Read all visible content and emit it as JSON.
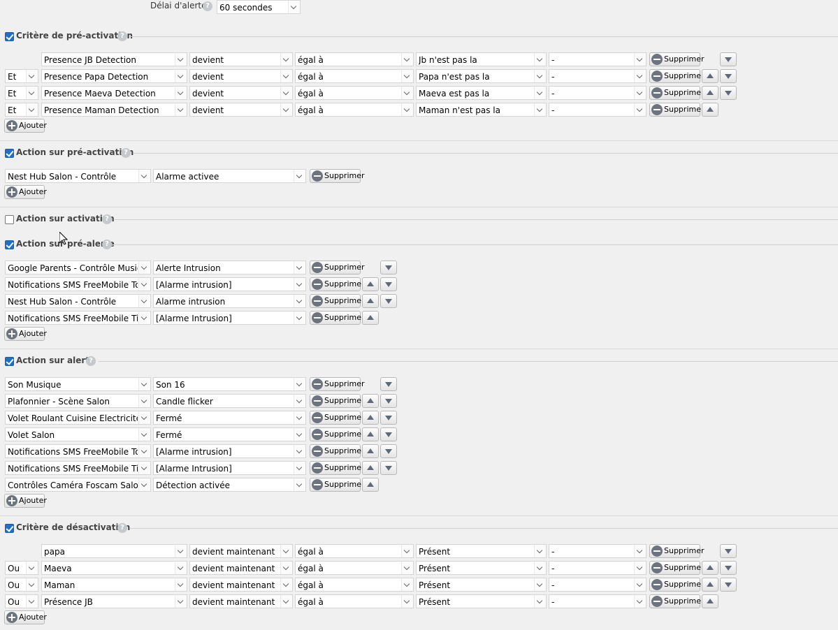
{
  "alert_delay": {
    "label": "Délai d'alerte",
    "value": "60 secondes"
  },
  "labels": {
    "delete": "Supprimer",
    "add": "Ajouter"
  },
  "sections": {
    "pre_activation_criteria": {
      "title": "Critère de pré-activation",
      "checked": true,
      "rows": [
        {
          "op": "",
          "cmd": "Presence JB Detection",
          "trigger": "devient",
          "cmp": "égal à",
          "val": "Jb n'est pas la",
          "extra": "-"
        },
        {
          "op": "Et",
          "cmd": "Presence Papa Detection",
          "trigger": "devient",
          "cmp": "égal à",
          "val": "Papa n'est pas la",
          "extra": "-"
        },
        {
          "op": "Et",
          "cmd": "Presence Maeva Detection",
          "trigger": "devient",
          "cmp": "égal à",
          "val": "Maeva est pas la",
          "extra": "-"
        },
        {
          "op": "Et",
          "cmd": "Presence Maman Detection",
          "trigger": "devient",
          "cmp": "égal à",
          "val": "Maman n'est pas la",
          "extra": "-"
        }
      ]
    },
    "pre_activation_action": {
      "title": "Action sur pré-activation",
      "checked": true,
      "rows": [
        {
          "device": "Nest Hub Salon - Contrôle",
          "value": "Alarme activee"
        }
      ]
    },
    "activation_action": {
      "title": "Action sur activation",
      "checked": false
    },
    "pre_alert_action": {
      "title": "Action sur pré-alerte",
      "checked": true,
      "rows": [
        {
          "device": "Google Parents - Contrôle Musique",
          "value": "Alerte Intrusion"
        },
        {
          "device": "Notifications SMS FreeMobile Tony",
          "value": "[Alarme intrusion]"
        },
        {
          "device": "Nest Hub Salon - Contrôle",
          "value": "Alarme intrusion"
        },
        {
          "device": "Notifications SMS FreeMobile Titia",
          "value": "[Alarme Intrusion]"
        }
      ]
    },
    "alert_action": {
      "title": "Action sur alerte",
      "checked": true,
      "rows": [
        {
          "device": "Son Musique",
          "value": "Son 16"
        },
        {
          "device": "Plafonnier - Scène Salon",
          "value": "Candle flicker"
        },
        {
          "device": "Volet Roulant Cuisine Electricite",
          "value": "Fermé"
        },
        {
          "device": "Volet Salon",
          "value": "Fermé"
        },
        {
          "device": "Notifications SMS FreeMobile Tony",
          "value": "[Alarme intrusion]"
        },
        {
          "device": "Notifications SMS FreeMobile Titia",
          "value": "[Alarme Intrusion]"
        },
        {
          "device": "Contrôles Caméra Foscam Salon",
          "value": "Détection activée"
        }
      ]
    },
    "deactivation_criteria": {
      "title": "Critère de désactivation",
      "checked": true,
      "rows": [
        {
          "op": "",
          "cmd": "papa",
          "trigger": "devient maintenant",
          "cmp": "égal à",
          "val": "Présent",
          "extra": "-"
        },
        {
          "op": "Ou",
          "cmd": "Maeva",
          "trigger": "devient maintenant",
          "cmp": "égal à",
          "val": "Présent",
          "extra": "-"
        },
        {
          "op": "Ou",
          "cmd": "Maman",
          "trigger": "devient maintenant",
          "cmp": "égal à",
          "val": "Présent",
          "extra": "-"
        },
        {
          "op": "Ou",
          "cmd": "Présence JB",
          "trigger": "devient maintenant",
          "cmp": "égal à",
          "val": "Présent",
          "extra": "-"
        }
      ]
    }
  }
}
